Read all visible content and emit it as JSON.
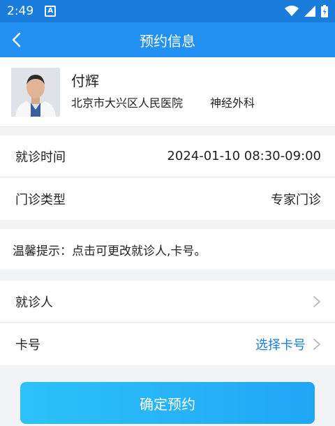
{
  "status_bar": {
    "time": "2:49",
    "notification_icon": "a-icon",
    "icons": [
      "wifi-icon",
      "signal-icon",
      "battery-icon"
    ]
  },
  "nav": {
    "title": "预约信息",
    "back_icon": "chevron-left-icon"
  },
  "doctor": {
    "name": "付辉",
    "hospital": "北京市大兴区人民医院",
    "department": "神经外科"
  },
  "appointment": {
    "time_label": "就诊时间",
    "time_value": "2024-01-10 08:30-09:00",
    "type_label": "门诊类型",
    "type_value": "专家门诊"
  },
  "tip": "温馨提示：点击可更改就诊人,卡号。",
  "patient": {
    "patient_label": "就诊人",
    "patient_value": "",
    "card_label": "卡号",
    "card_value": "选择卡号"
  },
  "confirm_label": "确定预约",
  "colors": {
    "primary": "#2390f3",
    "link": "#1a7ddc",
    "button_start": "#2cc2f9",
    "button_end": "#20a6f5"
  }
}
